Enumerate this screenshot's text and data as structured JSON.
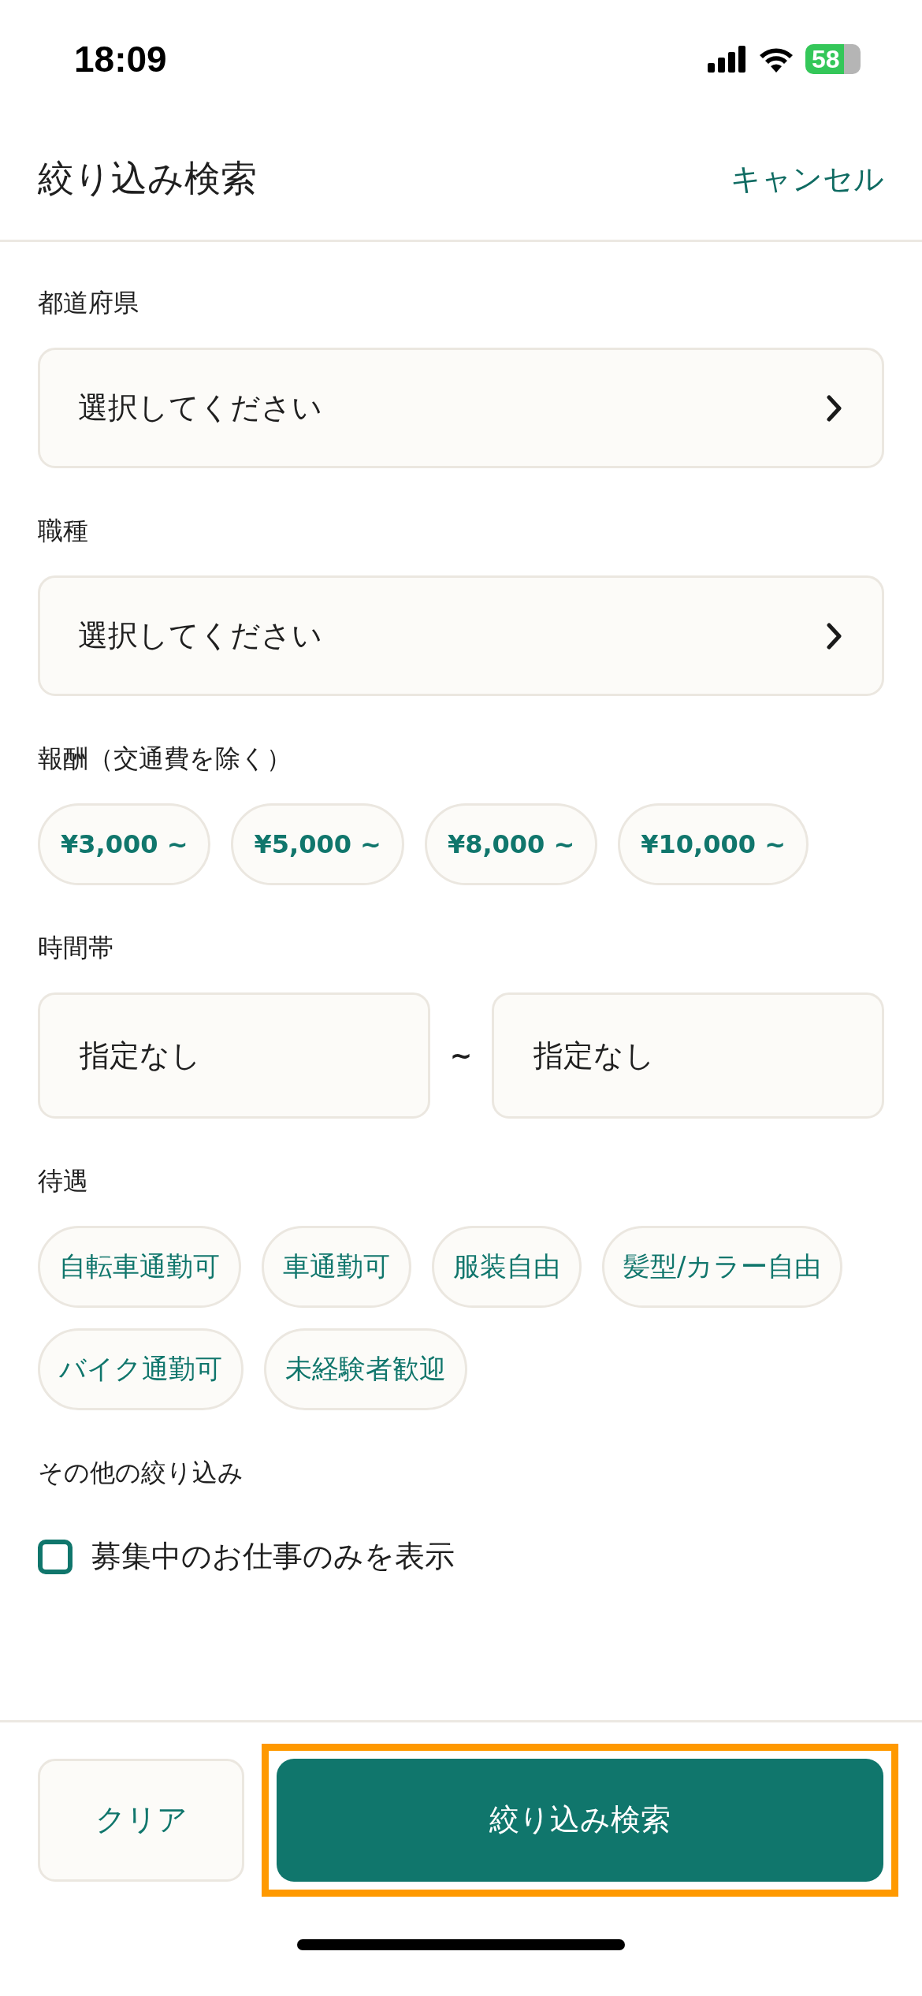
{
  "status_bar": {
    "time": "18:09",
    "battery": "58"
  },
  "header": {
    "title": "絞り込み検索",
    "cancel": "キャンセル"
  },
  "sections": [
    {
      "kind": "select",
      "label": "都道府県",
      "placeholder": "選択してください"
    },
    {
      "kind": "select",
      "label": "職種",
      "placeholder": "選択してください"
    },
    {
      "kind": "amount_chips",
      "label": "報酬（交通費を除く）",
      "chips": [
        {
          "label": "¥3,000 ~",
          "selected": false
        },
        {
          "label": "¥5,000 ~",
          "selected": false
        },
        {
          "label": "¥8,000 ~",
          "selected": false
        },
        {
          "label": "¥10,000 ~",
          "selected": false
        }
      ]
    },
    {
      "kind": "range",
      "label": "時間帯",
      "from": "指定なし",
      "separator": "~",
      "to": "指定なし"
    },
    {
      "kind": "chips",
      "label": "待遇",
      "chips": [
        {
          "label": "自転車通勤可",
          "selected": false
        },
        {
          "label": "車通勤可",
          "selected": false
        },
        {
          "label": "服装自由",
          "selected": false
        },
        {
          "label": "髪型/カラー自由",
          "selected": false
        },
        {
          "label": "バイク通勤可",
          "selected": false
        },
        {
          "label": "未経験者歓迎",
          "selected": false
        }
      ]
    },
    {
      "kind": "checkbox",
      "label": "その他の絞り込み",
      "option": "募集中のお仕事のみを表示",
      "checked": false
    }
  ],
  "footer": {
    "clear": "クリア",
    "search": "絞り込み検索",
    "highlighted": true
  }
}
